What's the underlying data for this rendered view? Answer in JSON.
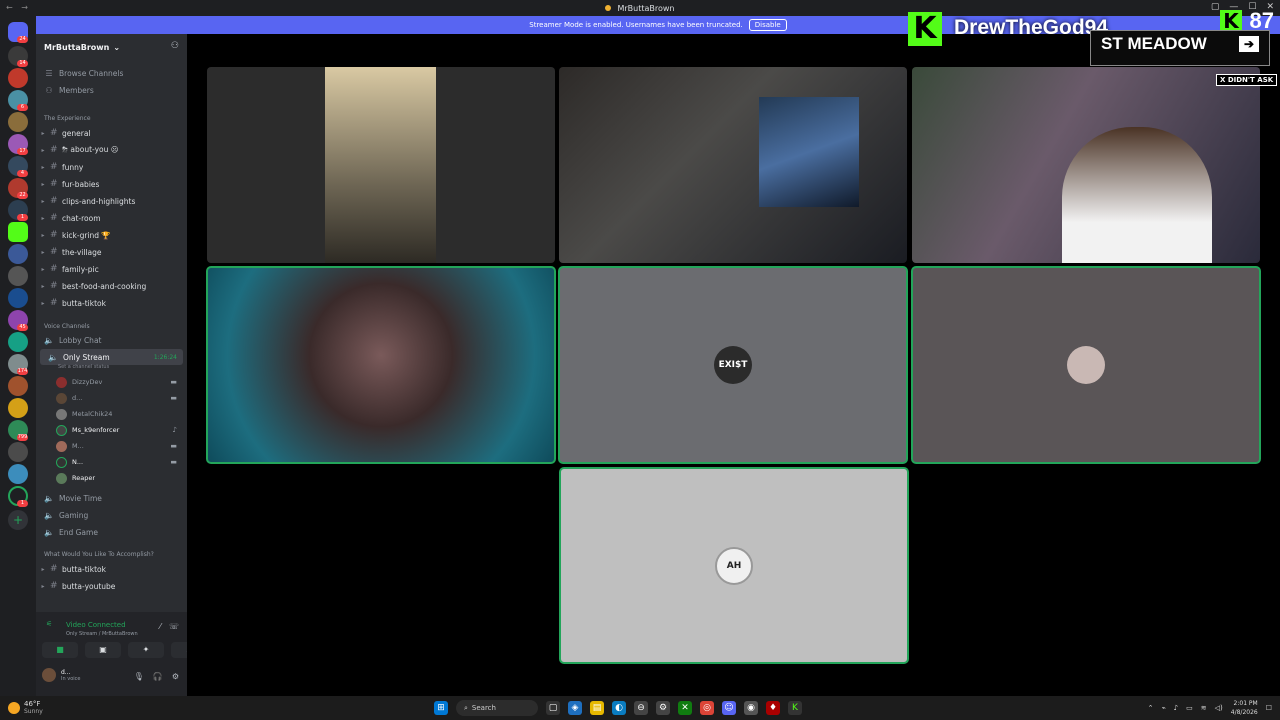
{
  "app": {
    "window_title": "MrButtaBrown"
  },
  "banner": {
    "text": "Streamer Mode is enabled. Usernames have been truncated.",
    "button": "Disable"
  },
  "guild_badges": [
    "24",
    "14",
    "6",
    "17",
    "4",
    "22",
    "1",
    "45",
    "174",
    "799",
    "1"
  ],
  "server": {
    "name": "MrButtaBrown"
  },
  "sidebar_top": [
    {
      "label": "Browse Channels",
      "icon": "browse-channels-icon"
    },
    {
      "label": "Members",
      "icon": "members-icon"
    }
  ],
  "categories": {
    "experience": "The Experience",
    "voice": "Voice Channels",
    "accomplish": "What Would You Like To Accomplish?"
  },
  "text_channels": [
    "general",
    "⛈ about-you ☹",
    "funny",
    "fur-babies",
    "clips-and-highlights",
    "chat-room",
    "kick-grind 🏆",
    "the-village",
    "family-pic",
    "best-food-and-cooking",
    "butta-tiktok"
  ],
  "voice_channels": {
    "lobby": "Lobby Chat",
    "active": {
      "name": "Only Stream",
      "timer": "1:26:24",
      "status": "Set a channel status"
    },
    "members": [
      "DizzyDev",
      "d...",
      "MetalChik24",
      "Ms_k9enforcer",
      "M...",
      "N...",
      "Reaper"
    ],
    "others": [
      "Movie Time",
      "Gaming",
      "End Game"
    ]
  },
  "accomplish_channels": [
    "butta-tiktok",
    "butta-youtube"
  ],
  "voice_connection": {
    "status": "Video Connected",
    "channel": "Only Stream / MrButtaBrown"
  },
  "user_panel": {
    "name": "d...",
    "status": "In voice"
  },
  "stream_overlay": {
    "streamer": "DrewTheGod94",
    "viewers": "87",
    "banner": "ST MEADOW",
    "tag": "X DIDN'T ASK"
  },
  "video_tiles": {
    "avatar_exist": "EXI$T",
    "avatar_ah": "AH"
  },
  "taskbar": {
    "temp": "46°F",
    "weather": "Sunny",
    "search": "Search",
    "time": "2:01 PM",
    "date": "4/8/2026"
  },
  "colors": {
    "discord_blurple": "#5865f2",
    "speaking_green": "#23a55a",
    "kick_green": "#53fc18"
  }
}
